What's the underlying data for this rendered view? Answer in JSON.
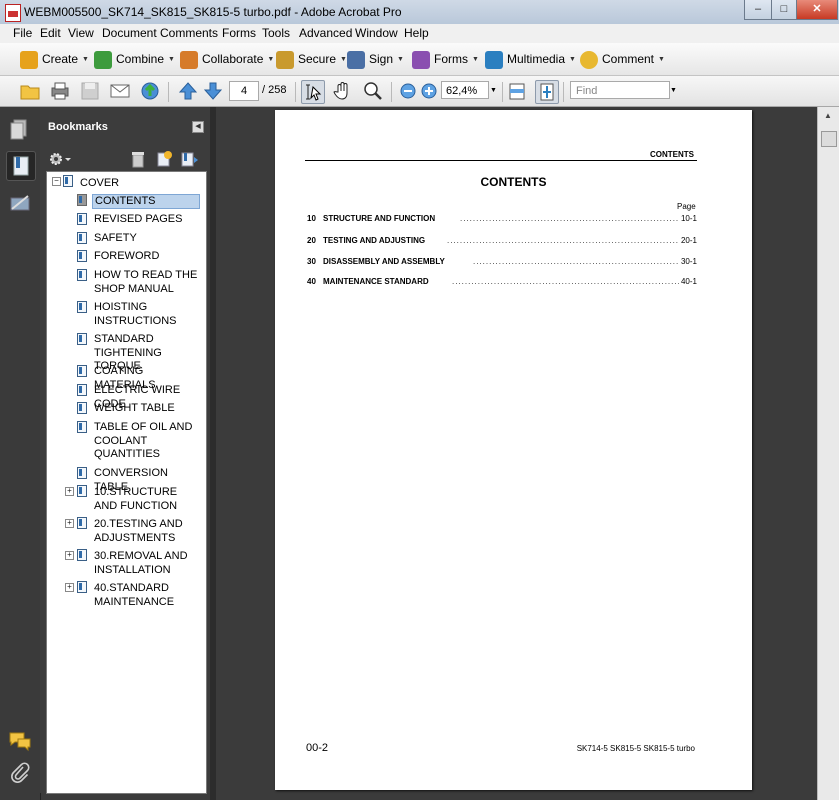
{
  "window": {
    "title": "WEBM005500_SK714_SK815_SK815-5 turbo.pdf - Adobe Acrobat Pro",
    "controls": [
      "–",
      "□",
      "✕"
    ]
  },
  "menu": [
    "File",
    "Edit",
    "View",
    "Document",
    "Comments",
    "Forms",
    "Tools",
    "Advanced",
    "Window",
    "Help"
  ],
  "tasks": [
    {
      "label": "Create",
      "icon": "create-icon",
      "color": "#e6a21c"
    },
    {
      "label": "Combine",
      "icon": "combine-icon",
      "color": "#3d9b3d"
    },
    {
      "label": "Collaborate",
      "icon": "collaborate-icon",
      "color": "#d67b2a"
    },
    {
      "label": "Secure",
      "icon": "lock-icon",
      "color": "#c99a2e"
    },
    {
      "label": "Sign",
      "icon": "pen-icon",
      "color": "#4a6fa5"
    },
    {
      "label": "Forms",
      "icon": "forms-icon",
      "color": "#8a4fb0"
    },
    {
      "label": "Multimedia",
      "icon": "multimedia-icon",
      "color": "#2b7fc0"
    },
    {
      "label": "Comment",
      "icon": "comment-icon",
      "color": "#e8b830"
    }
  ],
  "nav": {
    "page_current": "4",
    "page_total": "/ 258",
    "zoom": "62,4%",
    "find_placeholder": "Find"
  },
  "bookmarks": {
    "title": "Bookmarks",
    "items": [
      {
        "label": "COVER"
      },
      {
        "label": "CONTENTS"
      },
      {
        "label": "REVISED PAGES"
      },
      {
        "label": "SAFETY"
      },
      {
        "label": "FOREWORD"
      },
      {
        "label": "HOW TO READ THE SHOP MANUAL"
      },
      {
        "label": "HOISTING INSTRUCTIONS"
      },
      {
        "label": "STANDARD TIGHTENING TORQUE"
      },
      {
        "label": "COATING MATERIALS"
      },
      {
        "label": "ELECTRIC WIRE CODE"
      },
      {
        "label": "WEIGHT TABLE"
      },
      {
        "label": "TABLE OF OIL AND COOLANT QUANTITIES"
      },
      {
        "label": "CONVERSION TABLE"
      },
      {
        "label": "10.STRUCTURE AND FUNCTION"
      },
      {
        "label": "20.TESTING AND ADJUSTMENTS"
      },
      {
        "label": "30.REMOVAL AND INSTALLATION"
      },
      {
        "label": "40.STANDARD MAINTENANCE"
      }
    ]
  },
  "document": {
    "header": "CONTENTS",
    "title": "CONTENTS",
    "page_label": "Page",
    "toc": [
      {
        "num": "10",
        "title": "STRUCTURE AND FUNCTION",
        "page": "10-1"
      },
      {
        "num": "20",
        "title": "TESTING AND ADJUSTING",
        "page": "20-1"
      },
      {
        "num": "30",
        "title": "DISASSEMBLY AND ASSEMBLY",
        "page": "30-1"
      },
      {
        "num": "40",
        "title": "MAINTENANCE STANDARD",
        "page": "40-1"
      }
    ],
    "footer_left": "00-2",
    "footer_right": "SK714-5  SK815-5  SK815-5 turbo"
  }
}
